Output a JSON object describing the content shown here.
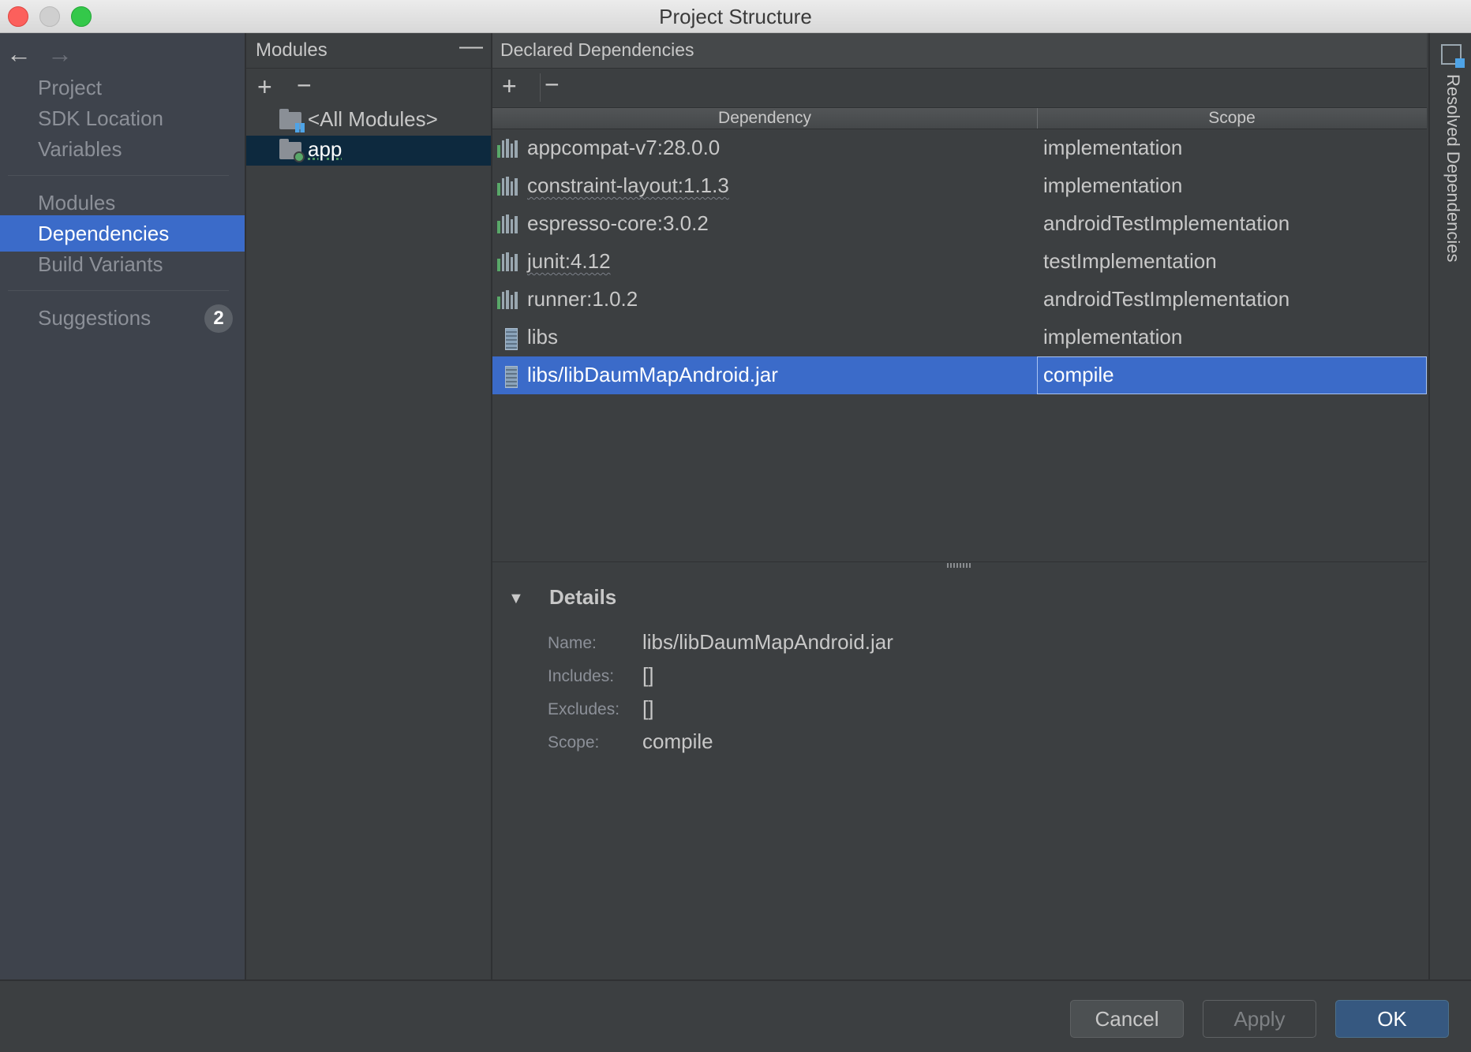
{
  "window": {
    "title": "Project Structure"
  },
  "nav": {
    "items": [
      "Project",
      "SDK Location",
      "Variables",
      "Modules",
      "Dependencies",
      "Build Variants"
    ],
    "selected": "Dependencies",
    "suggestions": {
      "label": "Suggestions",
      "count": "2"
    }
  },
  "modules": {
    "header": "Modules",
    "items": [
      "<All Modules>",
      "app"
    ],
    "selected": "app"
  },
  "declared": {
    "header": "Declared Dependencies",
    "columns": {
      "dependency": "Dependency",
      "scope": "Scope"
    },
    "rows": [
      {
        "name": "appcompat-v7:28.0.0",
        "scope": "implementation",
        "icon": "library-icon"
      },
      {
        "name": "constraint-layout:1.1.3",
        "scope": "implementation",
        "icon": "library-icon"
      },
      {
        "name": "espresso-core:3.0.2",
        "scope": "androidTestImplementation",
        "icon": "library-icon"
      },
      {
        "name": "junit:4.12",
        "scope": "testImplementation",
        "icon": "library-icon"
      },
      {
        "name": "runner:1.0.2",
        "scope": "androidTestImplementation",
        "icon": "library-icon"
      },
      {
        "name": "libs",
        "scope": "implementation",
        "icon": "jar-icon"
      },
      {
        "name": "libs/libDaumMapAndroid.jar",
        "scope": "compile",
        "icon": "jar-icon"
      }
    ],
    "selected_row": "libs/libDaumMapAndroid.jar"
  },
  "details": {
    "title": "Details",
    "name_label": "Name:",
    "name_value": "libs/libDaumMapAndroid.jar",
    "includes_label": "Includes:",
    "includes_value": "[]",
    "excludes_label": "Excludes:",
    "excludes_value": "[]",
    "scope_label": "Scope:",
    "scope_value": "compile"
  },
  "side_panel": {
    "label": "Resolved Dependencies"
  },
  "buttons": {
    "cancel": "Cancel",
    "apply": "Apply",
    "ok": "OK"
  },
  "colors": {
    "selection": "#3b6bc9",
    "panel_bg": "#3c3f41",
    "nav_bg": "#3e434c",
    "ok_button": "#365880"
  }
}
